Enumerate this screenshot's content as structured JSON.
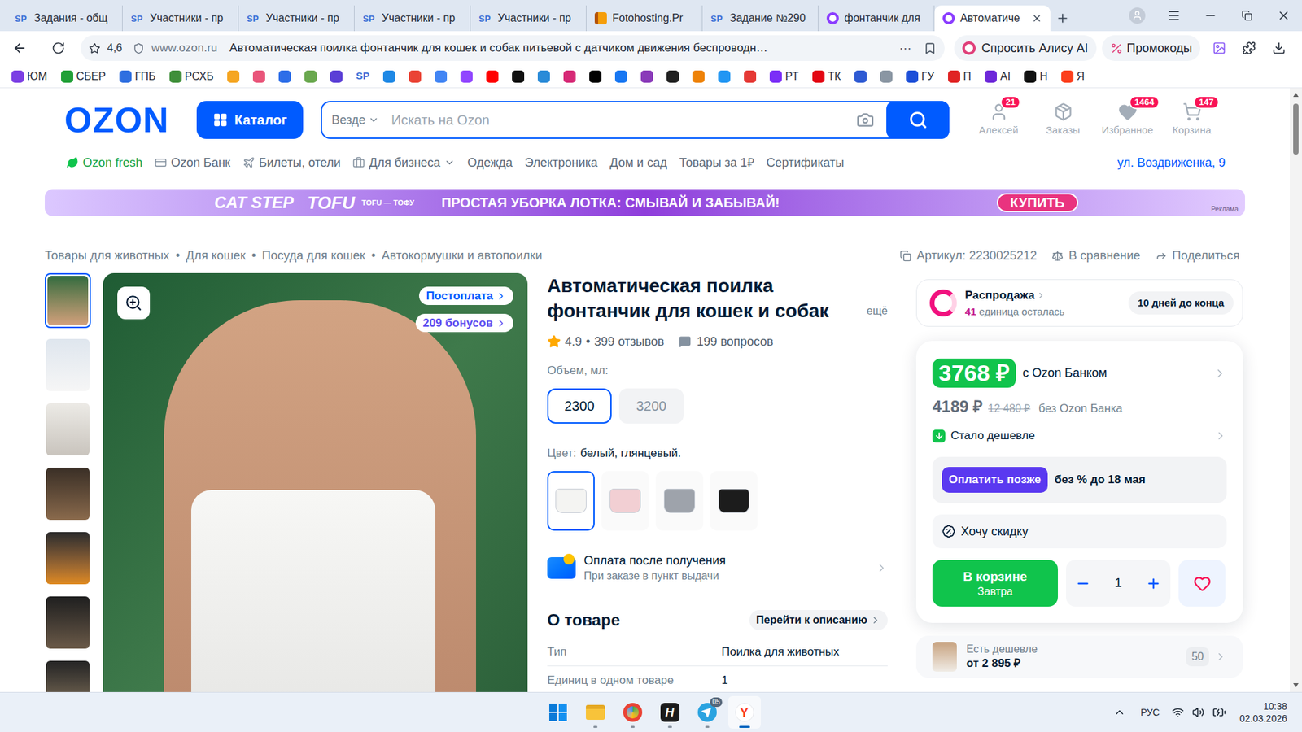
{
  "browser": {
    "tabs": [
      {
        "label": "Задания - общ",
        "kind": "sp",
        "icon_text": "SP",
        "selected": false
      },
      {
        "label": "Участники - пр",
        "kind": "sp",
        "icon_text": "SP",
        "selected": false
      },
      {
        "label": "Участники - пр",
        "kind": "sp",
        "icon_text": "SP",
        "selected": false
      },
      {
        "label": "Участники - пр",
        "kind": "sp",
        "icon_text": "SP",
        "selected": false
      },
      {
        "label": "Участники - пр",
        "kind": "sp",
        "icon_text": "SP",
        "selected": false
      },
      {
        "label": "Fotohosting.Pr",
        "kind": "fotohosting",
        "icon_text": "",
        "selected": false
      },
      {
        "label": "Задание №290",
        "kind": "sp",
        "icon_text": "SP",
        "selected": false
      },
      {
        "label": "фонтанчик для",
        "kind": "ozon",
        "icon_text": "",
        "selected": false
      },
      {
        "label": "Автоматиче",
        "kind": "ozon",
        "icon_text": "",
        "selected": true
      }
    ],
    "address_bar": {
      "rating": "4,6",
      "domain": "www.ozon.ru",
      "title": "Автоматическая поилка фонтанчик для кошек и собак питьевой с датчиком движения беспроводн…",
      "more": "⋯"
    },
    "alice": "Спросить Алису AI",
    "promo": "Промокоды",
    "bookmarks": [
      {
        "label": "ЮМ",
        "kind": "labeled",
        "color": "#7b3fe4"
      },
      {
        "label": "СБЕР",
        "kind": "labeled",
        "color": "#21a038"
      },
      {
        "label": "ГПБ",
        "kind": "labeled",
        "color": "#2f6fe0"
      },
      {
        "label": "РСХБ",
        "kind": "labeled",
        "color": "#3f8f3a"
      },
      {
        "label": "",
        "kind": "icon",
        "color": "#f5a623"
      },
      {
        "label": "",
        "kind": "icon",
        "color": "#e9557a"
      },
      {
        "label": "",
        "kind": "icon",
        "color": "#2d6ee8"
      },
      {
        "label": "",
        "kind": "icon",
        "color": "#6aa84f"
      },
      {
        "label": "",
        "kind": "icon",
        "color": "#5b3fd6"
      },
      {
        "label": "SP",
        "kind": "text",
        "color": "#3b6fd6"
      },
      {
        "label": "",
        "kind": "icon",
        "color": "#1e88e5"
      },
      {
        "label": "",
        "kind": "icon",
        "color": "#ea4335"
      },
      {
        "label": "",
        "kind": "icon",
        "color": "#4285f4"
      },
      {
        "label": "",
        "kind": "icon",
        "color": "#9146ff"
      },
      {
        "label": "",
        "kind": "icon",
        "color": "#ff0000"
      },
      {
        "label": "",
        "kind": "icon",
        "color": "#111111"
      },
      {
        "label": "",
        "kind": "icon",
        "color": "#2a8bd8"
      },
      {
        "label": "",
        "kind": "icon",
        "color": "#d62976"
      },
      {
        "label": "",
        "kind": "icon",
        "color": "#010101"
      },
      {
        "label": "",
        "kind": "icon",
        "color": "#1877f2"
      },
      {
        "label": "",
        "kind": "icon",
        "color": "#8a3ab9"
      },
      {
        "label": "",
        "kind": "icon",
        "color": "#222222"
      },
      {
        "label": "",
        "kind": "icon",
        "color": "#ee8208"
      },
      {
        "label": "",
        "kind": "icon",
        "color": "#2196f3"
      },
      {
        "label": "",
        "kind": "icon",
        "color": "#e53935"
      },
      {
        "label": "РТ",
        "kind": "labeled",
        "color": "#7b2ff7"
      },
      {
        "label": "ТК",
        "kind": "labeled",
        "color": "#e30613"
      },
      {
        "label": "",
        "kind": "icon",
        "color": "#2f5bd3"
      },
      {
        "label": "",
        "kind": "icon",
        "color": "#8a96a3"
      },
      {
        "label": "ГУ",
        "kind": "labeled",
        "color": "#1d4fd8"
      },
      {
        "label": "П",
        "kind": "labeled",
        "color": "#e02424"
      },
      {
        "label": "AI",
        "kind": "labeled",
        "color": "#6d28d9"
      },
      {
        "label": "Н",
        "kind": "labeled",
        "color": "#111111"
      },
      {
        "label": "Я",
        "kind": "labeled",
        "color": "#fc3f1d"
      }
    ]
  },
  "page": {
    "header": {
      "logo": "OZON",
      "catalog": "Каталог",
      "scope": "Везде",
      "placeholder": "Искать на Ozon",
      "actions": [
        {
          "label": "Алексей",
          "kind": "profile",
          "badge": "21"
        },
        {
          "label": "Заказы",
          "kind": "orders"
        },
        {
          "label": "Избранное",
          "kind": "favorites",
          "badge": "1464"
        },
        {
          "label": "Корзина",
          "kind": "cart",
          "badge": "147"
        }
      ]
    },
    "nav": [
      {
        "label": "Ozon fresh",
        "kind": "fresh"
      },
      {
        "label": "Ozon Банк",
        "kind": "bank"
      },
      {
        "label": "Билеты, отели",
        "kind": "tickets"
      },
      {
        "label": "Для бизнеса",
        "kind": "business"
      },
      {
        "label": "Одежда",
        "kind": "plain"
      },
      {
        "label": "Электроника",
        "kind": "plain"
      },
      {
        "label": "Дом и сад",
        "kind": "plain"
      },
      {
        "label": "Товары за 1₽",
        "kind": "plain"
      },
      {
        "label": "Сертификаты",
        "kind": "plain"
      }
    ],
    "delivery_address": "ул. Воздвиженка, 9",
    "banner": {
      "brand": "CAT STEP",
      "product": "TOFU",
      "product_sub": "TOFU — ТОФУ",
      "slogan": "ПРОСТАЯ УБОРКА ЛОТКА: СМЫВАЙ И ЗАБЫВАЙ!",
      "cta": "КУПИТЬ",
      "ad_label": "Реклама"
    },
    "breadcrumbs": [
      "Товары для животных",
      "Для кошек",
      "Посуда для кошек",
      "Автокормушки и автопоилки"
    ],
    "breadcrumb_separator": "•",
    "article": "Артикул: 2230025212",
    "compare": "В сравнение",
    "share": "Поделиться",
    "gallery": {
      "thumbnails": [
        {
          "selected": true
        },
        {
          "selected": false
        },
        {
          "selected": false
        },
        {
          "selected": false
        },
        {
          "selected": false
        },
        {
          "selected": false
        },
        {
          "selected": false
        }
      ],
      "badges": [
        {
          "label": "Постоплата",
          "color": "#005bff"
        },
        {
          "label": "209 бонусов",
          "color": "#5b4cf0"
        }
      ]
    },
    "product": {
      "title": "Автоматическая поилка фонтанчик для кошек и собак",
      "more": "ещё",
      "rating": "4.9",
      "rating_separator": "•",
      "reviews": "399 отзывов",
      "questions": "199 вопросов",
      "volume_label": "Объем, мл:",
      "volumes": [
        {
          "label": "2300",
          "selected": true
        },
        {
          "label": "3200",
          "selected": false
        }
      ],
      "color_label": "Цвет:",
      "color_value": "белый, глянцевый.",
      "colors": [
        {
          "color": "#f4f4f2",
          "selected": true
        },
        {
          "color": "#f2cfd3",
          "selected": false
        },
        {
          "color": "#9ea3ab",
          "selected": false
        },
        {
          "color": "#1c1c1c",
          "selected": false
        }
      ],
      "payment_title": "Оплата после получения",
      "payment_subtitle": "При заказе в пункт выдачи",
      "about": "О товаре",
      "to_description": "Перейти к описанию",
      "specs": [
        {
          "name": "Тип",
          "value": "Поилка для животных"
        },
        {
          "name": "Единиц в одном товаре",
          "value": "1"
        }
      ]
    },
    "sale": {
      "title": "Распродажа",
      "left_count": "41",
      "left_text": "единица осталась",
      "ends": "10 дней до конца"
    },
    "price": {
      "bank_price": "3768 ₽",
      "bank_label": "с Ozon Банком",
      "price": "4189 ₽",
      "old_price": "12 480 ₽",
      "no_bank_label": "без Ozon Банка",
      "price_drop": "Стало дешевле",
      "pay_later": "Оплатить позже",
      "pay_later_note": "без % до 18 мая",
      "want_discount": "Хочу скидку",
      "cart_button": "В корзине",
      "delivery": "Завтра",
      "quantity": "1",
      "favorite": false
    },
    "cheaper": {
      "label": "Есть дешевле",
      "price": "от 2 895 ₽",
      "count": "50"
    }
  },
  "taskbar": {
    "apps": [
      {
        "kind": "start",
        "icon_text": "",
        "running": false,
        "selected": false
      },
      {
        "kind": "explorer",
        "icon_text": "",
        "running": true,
        "selected": false
      },
      {
        "kind": "edge",
        "icon_text": "",
        "running": true,
        "selected": false
      },
      {
        "kind": "hiddify",
        "icon_text": "H",
        "running": true,
        "selected": false
      },
      {
        "kind": "telegram",
        "icon_text": "",
        "badge": "05",
        "running": true,
        "selected": false
      },
      {
        "kind": "yandex",
        "icon_text": "Y",
        "running": true,
        "selected": true
      }
    ],
    "language": "РУС",
    "time": "10:38",
    "date": "02.03.2026"
  }
}
